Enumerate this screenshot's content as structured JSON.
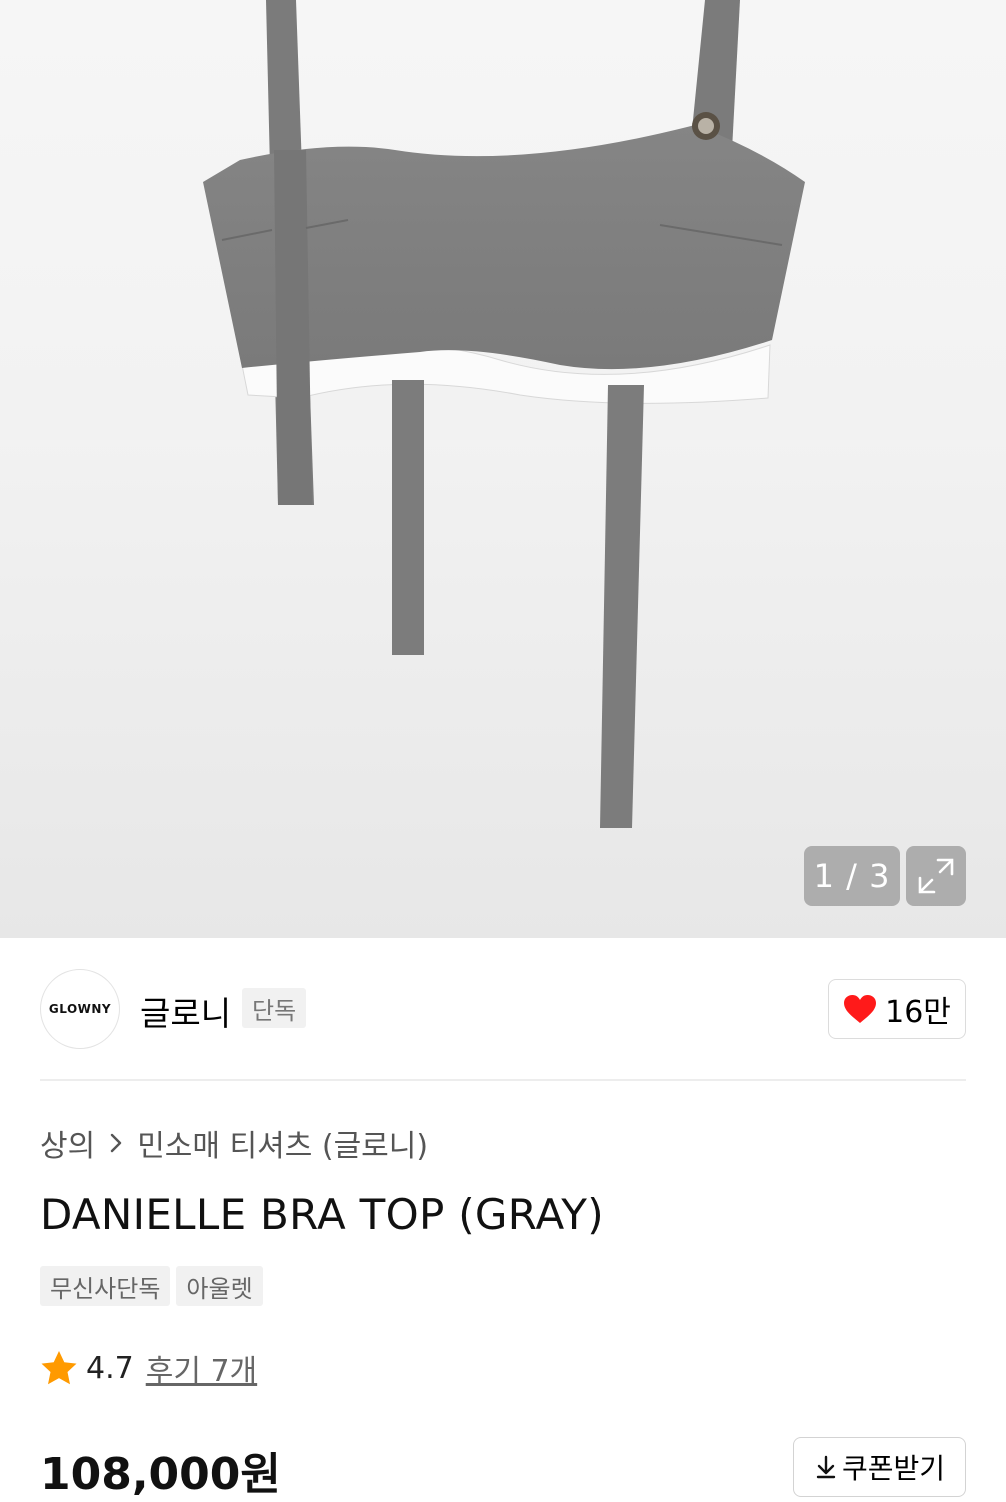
{
  "gallery": {
    "image_alt": "DANIELLE BRA TOP (GRAY) product photo",
    "counter": "1 / 3",
    "expand_icon": "expand-icon"
  },
  "brand": {
    "logo_text": "GLOWNY",
    "name": "글로니",
    "exclusive_tag": "단독",
    "like_icon": "heart-icon",
    "like_count": "16만",
    "colors": {
      "heart": "#ff1a1a"
    }
  },
  "breadcrumb": {
    "category": "상의",
    "separator_icon": "chevron-right-icon",
    "subcategory": "민소매 티셔츠 (글로니)"
  },
  "product": {
    "title": "DANIELLE BRA TOP (GRAY)",
    "tags": [
      "무신사단독",
      "아울렛"
    ],
    "rating_icon": "star-icon",
    "rating": "4.7",
    "reviews": "후기 7개",
    "price": "108,000원",
    "coupon_label": "쿠폰받기",
    "coupon_icon": "download-icon",
    "colors": {
      "star": "#ff9a00"
    }
  }
}
